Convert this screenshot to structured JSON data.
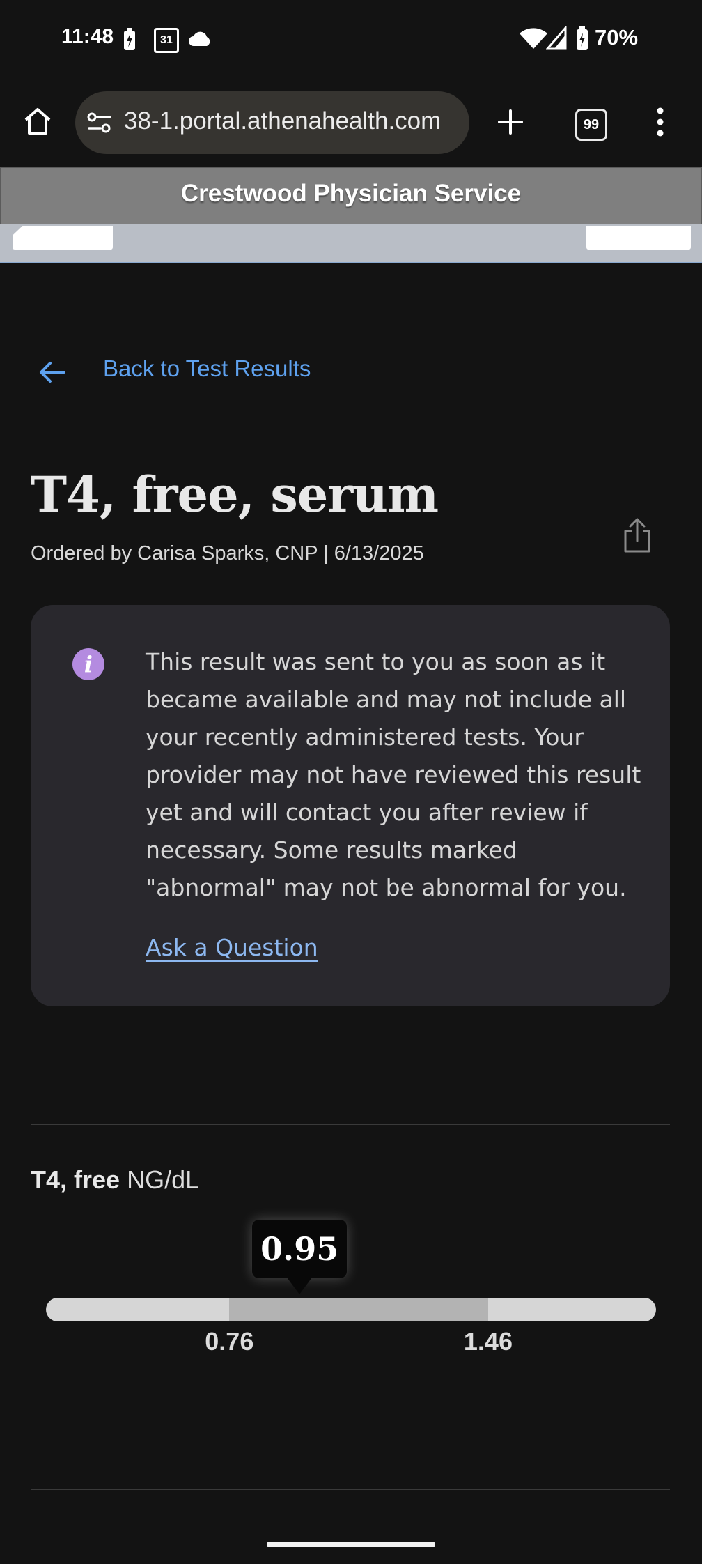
{
  "status_bar": {
    "time": "11:48",
    "battery": "70%",
    "icons": [
      "battery-charging-icon",
      "calendar-icon",
      "cloud-icon",
      "wifi-icon",
      "signal-icon",
      "battery-icon"
    ],
    "calendar_day": "31"
  },
  "browser": {
    "url": "38-1.portal.athenahealth.com",
    "tab_count": "99",
    "icons": [
      "home-icon",
      "site-info-icon",
      "new-tab-icon",
      "tab-switcher-icon",
      "more-menu-icon"
    ]
  },
  "site": {
    "title": "Crestwood Physician Service"
  },
  "page": {
    "back_label": "Back to Test Results",
    "title": "T4, free, serum",
    "ordered_by": "Ordered by Carisa Sparks, CNP | 6/13/2025"
  },
  "info_card": {
    "message": "This result was sent to you as soon as it became available and may not include all your recently administered tests. Your provider may not have reviewed this result yet and will contact you after review if necessary. Some results marked \"abnormal\" may not be abnormal for you.",
    "ask_label": "Ask a Question"
  },
  "result": {
    "name": "T4, free",
    "unit": "NG/dL",
    "value": 0.95,
    "value_label": "0.95",
    "range_low": 0.76,
    "range_high": 1.46,
    "range_low_label": "0.76",
    "range_high_label": "1.46",
    "scale_min": 0.264,
    "scale_max": 1.914
  },
  "colors": {
    "background": "#131313",
    "link": "#5ea1ee",
    "card": "#29282d",
    "info_icon": "#b48be0",
    "track": "#d6d6d6",
    "normal_range": "#b3b3b3"
  }
}
